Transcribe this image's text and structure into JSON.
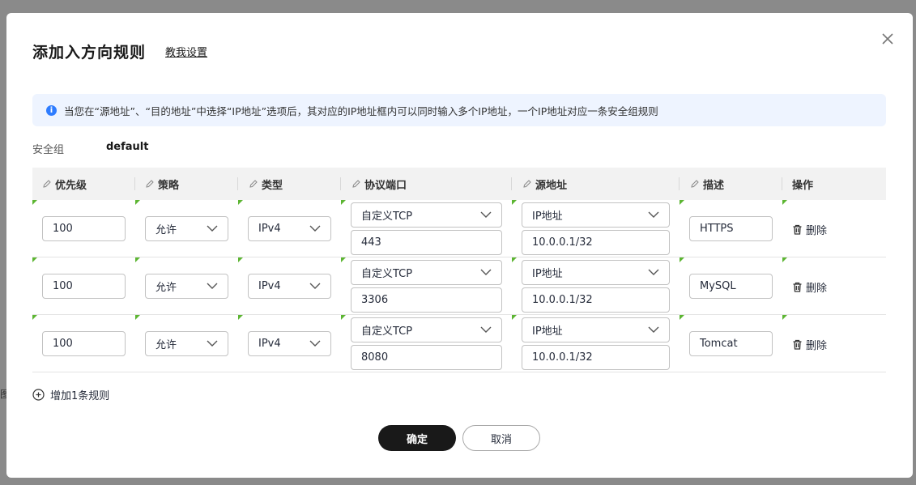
{
  "backdrop": {
    "fragment": "图"
  },
  "dialog": {
    "title": "添加入方向规则",
    "help_link": "教我设置",
    "notice": "当您在“源地址”、“目的地址”中选择“IP地址”选项后，其对应的IP地址框内可以同时输入多个IP地址，一个IP地址对应一条安全组规则",
    "security_group": {
      "label": "安全组",
      "value": "default"
    }
  },
  "table": {
    "headers": [
      "优先级",
      "策略",
      "类型",
      "协议端口",
      "源地址",
      "描述",
      "操作"
    ],
    "rows": [
      {
        "priority": "100",
        "policy": "允许",
        "type": "IPv4",
        "protocol": "自定义TCP",
        "port": "443",
        "source_type": "IP地址",
        "source": "10.0.0.1/32",
        "description": "HTTPS",
        "action": "删除"
      },
      {
        "priority": "100",
        "policy": "允许",
        "type": "IPv4",
        "protocol": "自定义TCP",
        "port": "3306",
        "source_type": "IP地址",
        "source": "10.0.0.1/32",
        "description": "MySQL",
        "action": "删除"
      },
      {
        "priority": "100",
        "policy": "允许",
        "type": "IPv4",
        "protocol": "自定义TCP",
        "port": "8080",
        "source_type": "IP地址",
        "source": "10.0.0.1/32",
        "description": "Tomcat",
        "action": "删除"
      }
    ]
  },
  "add_rule": "增加1条规则",
  "buttons": {
    "ok": "确定",
    "cancel": "取消"
  },
  "colors": {
    "accent": "#191919",
    "info": "#2e7cff",
    "notice_bg": "#eef4ff",
    "required_marker": "#5cb532"
  }
}
